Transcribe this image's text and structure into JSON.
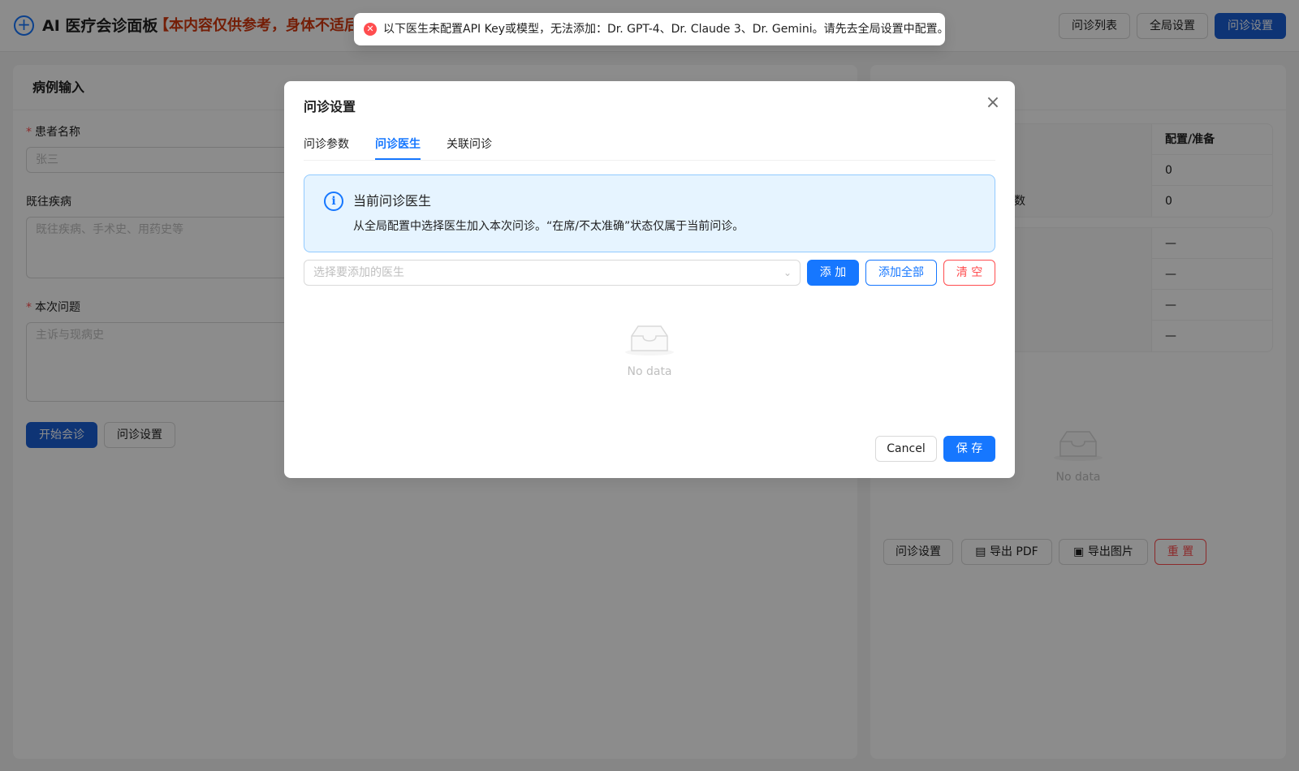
{
  "header": {
    "title": "AI 医疗会诊面板",
    "disclaimer": "【本内容仅供参考，身体不适后",
    "buttons": {
      "list": "问诊列表",
      "global": "全局设置",
      "session": "问诊设置"
    }
  },
  "case_form": {
    "title": "病例输入",
    "patient_label": "患者名称",
    "patient_placeholder": "张三",
    "history_label": "既往疾病",
    "history_placeholder": "既往疾病、手术史、用药史等",
    "issue_label": "本次问题",
    "issue_placeholder": "主诉与现病史",
    "start_button": "开始会诊",
    "settings_button": "问诊设置"
  },
  "status_panel": {
    "header_value": "配置/准备",
    "rows": [
      {
        "label": "",
        "value": "0"
      },
      {
        "label": "数",
        "value": "0"
      }
    ],
    "rows2": [
      "—",
      "—",
      "—",
      "—"
    ],
    "empty_text": "No data",
    "buttons": {
      "settings": "问诊设置",
      "pdf": "导出 PDF",
      "image": "导出图片",
      "reset": "重 置"
    }
  },
  "modal": {
    "title": "问诊设置",
    "tabs": [
      "问诊参数",
      "问诊医生",
      "关联问诊"
    ],
    "active_tab": 1,
    "alert": {
      "title": "当前问诊医生",
      "description": "从全局配置中选择医生加入本次问诊。“在席/不太准确”状态仅属于当前问诊。"
    },
    "select_placeholder": "选择要添加的医生",
    "add_button": "添 加",
    "add_all_button": "添加全部",
    "clear_button": "清 空",
    "empty_text": "No data",
    "cancel_button": "Cancel",
    "save_button": "保 存"
  },
  "toast": {
    "message": "以下医生未配置API Key或模型，无法添加：Dr. GPT-4、Dr. Claude 3、Dr. Gemini。请先去全局设置中配置。"
  },
  "colors": {
    "primary": "#1677ff",
    "danger": "#ff4d4f",
    "disclaimer": "#d4380d"
  }
}
